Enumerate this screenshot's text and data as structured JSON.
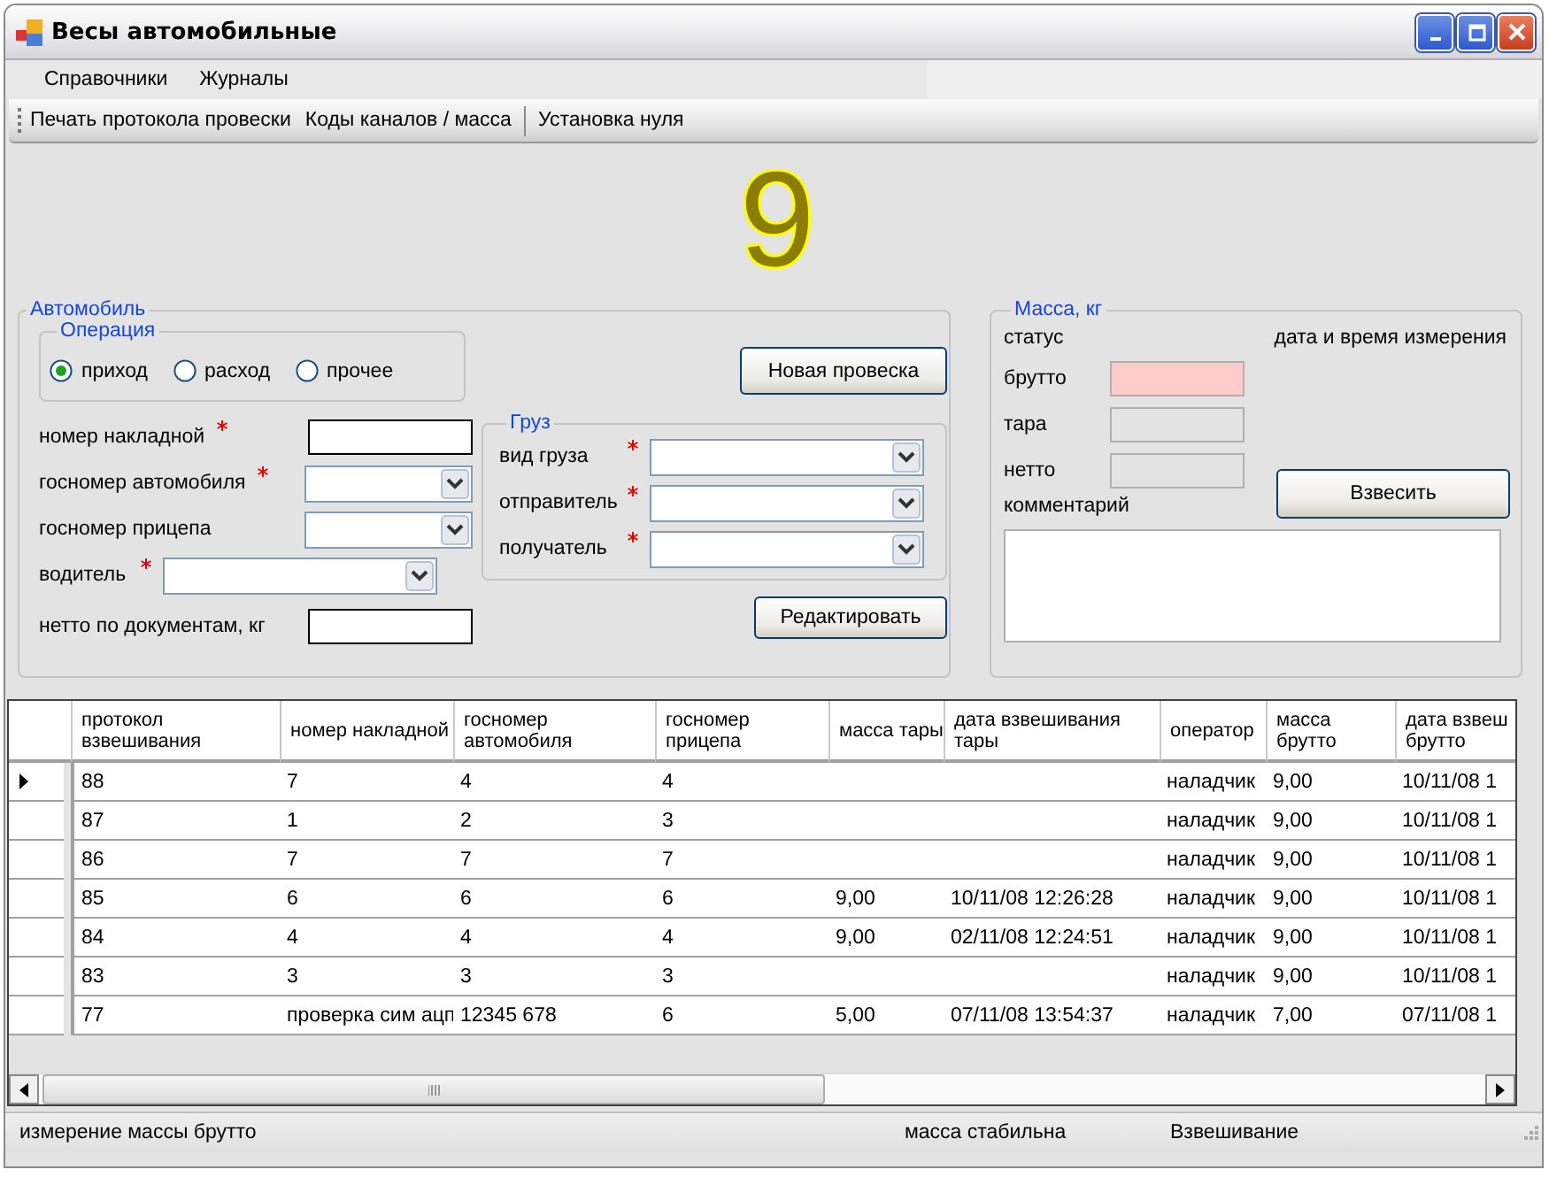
{
  "window": {
    "title": "Весы автомобильные"
  },
  "menu": [
    "Справочники",
    "Журналы"
  ],
  "toolbar": [
    {
      "kind": "button",
      "label": "Печать протокола провески"
    },
    {
      "kind": "button",
      "label": "Коды каналов / масса"
    },
    {
      "kind": "separator"
    },
    {
      "kind": "button",
      "label": "Установка нуля"
    }
  ],
  "display": {
    "value": "9"
  },
  "vehicle": {
    "title": "Автомобиль",
    "operation": {
      "title": "Операция",
      "options": [
        {
          "label": "приход",
          "selected": true
        },
        {
          "label": "расход",
          "selected": false
        },
        {
          "label": "прочее",
          "selected": false
        }
      ]
    },
    "fields": [
      {
        "label": "номер накладной",
        "required": true,
        "kind": "text"
      },
      {
        "label": "госномер автомобиля",
        "required": true,
        "kind": "combo"
      },
      {
        "label": "госномер прицепа",
        "required": false,
        "kind": "combo"
      },
      {
        "label": "водитель",
        "required": true,
        "kind": "wide-combo"
      },
      {
        "label": "нетто по документам, кг",
        "required": false,
        "kind": "text"
      }
    ],
    "new_button": "Новая провеска",
    "cargo": {
      "title": "Груз",
      "fields": [
        {
          "label": "вид груза",
          "required": true
        },
        {
          "label": "отправитель",
          "required": true
        },
        {
          "label": "получатель",
          "required": true
        }
      ]
    },
    "edit_button": "Редактировать"
  },
  "mass": {
    "title": "Масса, кг",
    "status_label": "статус",
    "datetime_label": "дата и время измерения",
    "fields": [
      {
        "label": "брутто",
        "highlighted": true
      },
      {
        "label": "тара",
        "highlighted": false
      },
      {
        "label": "нетто",
        "highlighted": false
      }
    ],
    "weigh_button": "Взвесить",
    "comment_label": "комментарий"
  },
  "table": {
    "columns": [
      {
        "label": "протокол взвешивания"
      },
      {
        "label": "номер накладной"
      },
      {
        "label": "госномер автомобиля"
      },
      {
        "label": "госномер прицепа"
      },
      {
        "label": "масса тары"
      },
      {
        "label": "дата взвешивания тары"
      },
      {
        "label": "оператор"
      },
      {
        "label": "масса брутто"
      },
      {
        "label": "дата взвеш брутто"
      }
    ],
    "rows": [
      {
        "current": true,
        "cells": [
          "88",
          "7",
          "4",
          "4",
          "",
          "",
          "наладчик",
          "9,00",
          "10/11/08 1"
        ]
      },
      {
        "current": false,
        "cells": [
          "87",
          "1",
          "2",
          "3",
          "",
          "",
          "наладчик",
          "9,00",
          "10/11/08 1"
        ]
      },
      {
        "current": false,
        "cells": [
          "86",
          "7",
          "7",
          "7",
          "",
          "",
          "наладчик",
          "9,00",
          "10/11/08 1"
        ]
      },
      {
        "current": false,
        "cells": [
          "85",
          "6",
          "6",
          "6",
          "9,00",
          "10/11/08 12:26:28",
          "наладчик",
          "9,00",
          "10/11/08 1"
        ]
      },
      {
        "current": false,
        "cells": [
          "84",
          "4",
          "4",
          "4",
          "9,00",
          "02/11/08 12:24:51",
          "наладчик",
          "9,00",
          "10/11/08 1"
        ]
      },
      {
        "current": false,
        "cells": [
          "83",
          "3",
          "3",
          "3",
          "",
          "",
          "наладчик",
          "9,00",
          "10/11/08 1"
        ]
      },
      {
        "current": false,
        "cells": [
          "77",
          "проверка сим ацп",
          "12345 678",
          "6",
          "5,00",
          "07/11/08 13:54:37",
          "наладчик",
          "7,00",
          "07/11/08 1"
        ]
      }
    ]
  },
  "status_bar": [
    "измерение массы брутто",
    "масса стабильна",
    "Взвешивание"
  ]
}
